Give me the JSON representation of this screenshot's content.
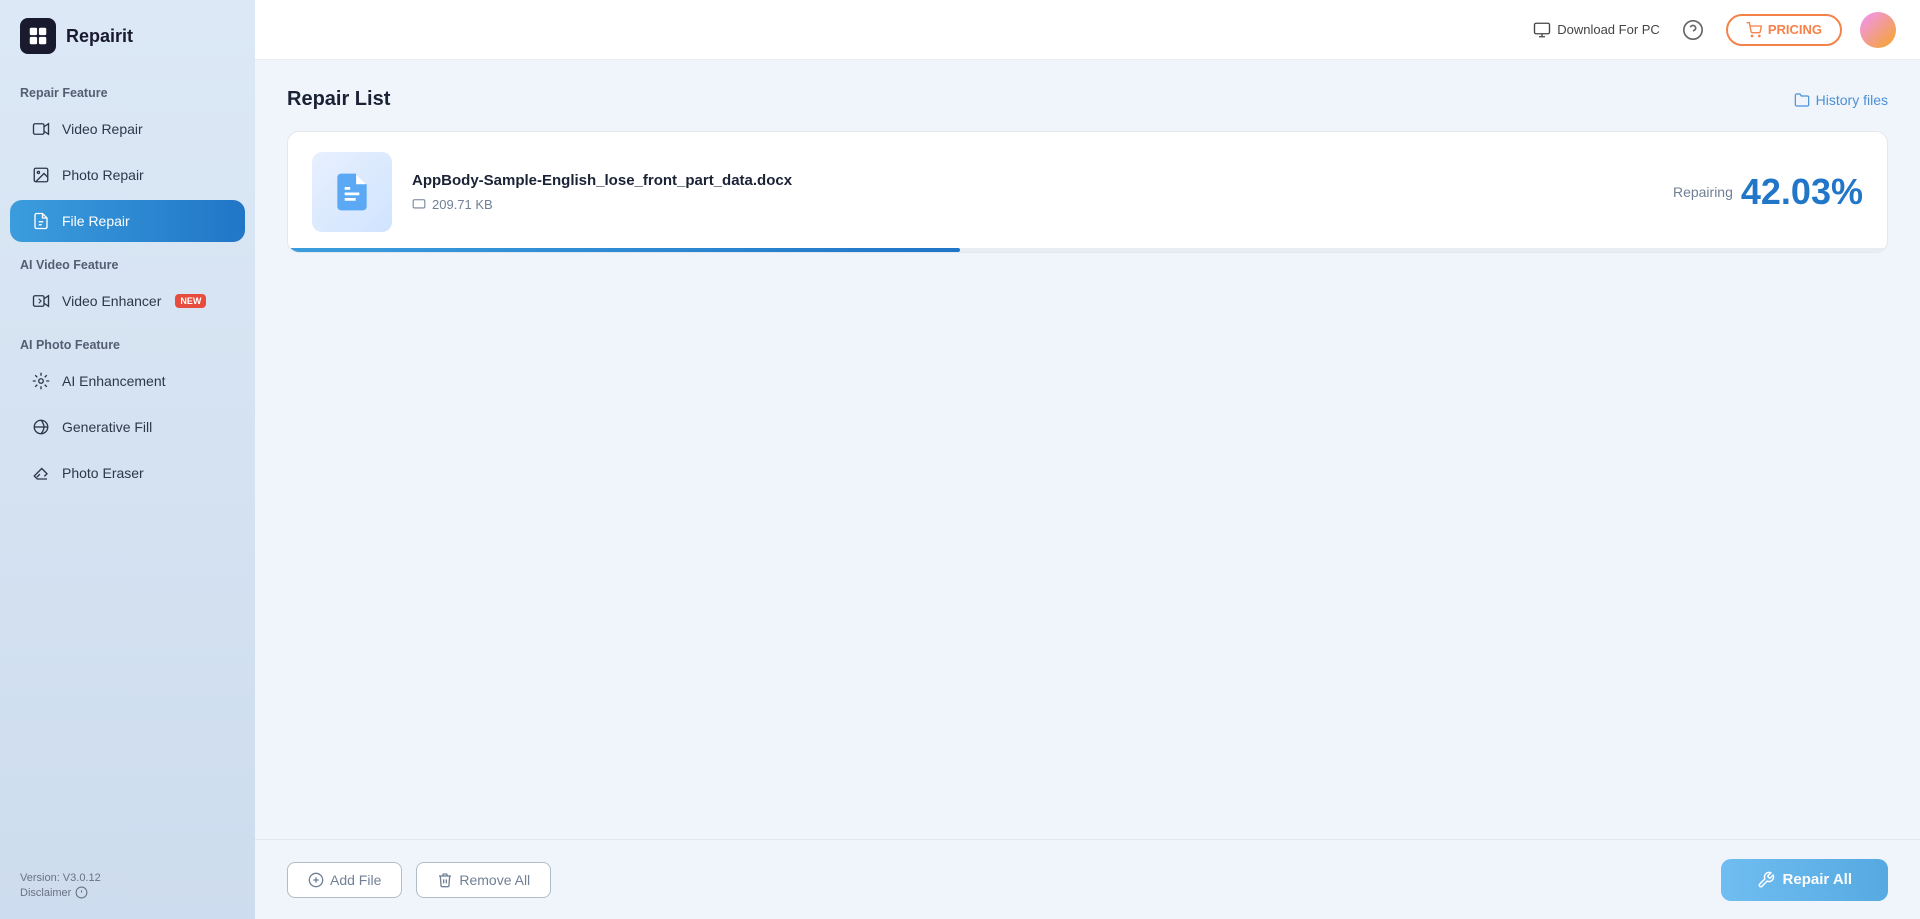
{
  "app": {
    "name": "Repairit"
  },
  "header": {
    "download_label": "Download For PC",
    "pricing_label": "PRICING",
    "pricing_icon": "cart-icon"
  },
  "sidebar": {
    "sections": [
      {
        "label": "Repair Feature",
        "items": [
          {
            "id": "video-repair",
            "label": "Video Repair",
            "active": false
          },
          {
            "id": "photo-repair",
            "label": "Photo Repair",
            "active": false
          },
          {
            "id": "file-repair",
            "label": "File Repair",
            "active": true
          }
        ]
      },
      {
        "label": "AI Video Feature",
        "items": [
          {
            "id": "video-enhancer",
            "label": "Video Enhancer",
            "active": false,
            "badge": "NEW"
          }
        ]
      },
      {
        "label": "AI Photo Feature",
        "items": [
          {
            "id": "ai-enhancement",
            "label": "AI Enhancement",
            "active": false
          },
          {
            "id": "generative-fill",
            "label": "Generative Fill",
            "active": false
          },
          {
            "id": "photo-eraser",
            "label": "Photo Eraser",
            "active": false
          }
        ]
      }
    ],
    "version": "Version: V3.0.12",
    "disclaimer": "Disclaimer"
  },
  "repair": {
    "title": "Repair List",
    "history_label": "History files",
    "file": {
      "name": "AppBody-Sample-English_lose_front_part_data.docx",
      "size": "209.71 KB",
      "status": "Repairing",
      "percent": "42.03%",
      "progress": 42.03
    }
  },
  "toolbar": {
    "add_file_label": "Add File",
    "remove_all_label": "Remove All",
    "repair_all_label": "Repair All"
  }
}
